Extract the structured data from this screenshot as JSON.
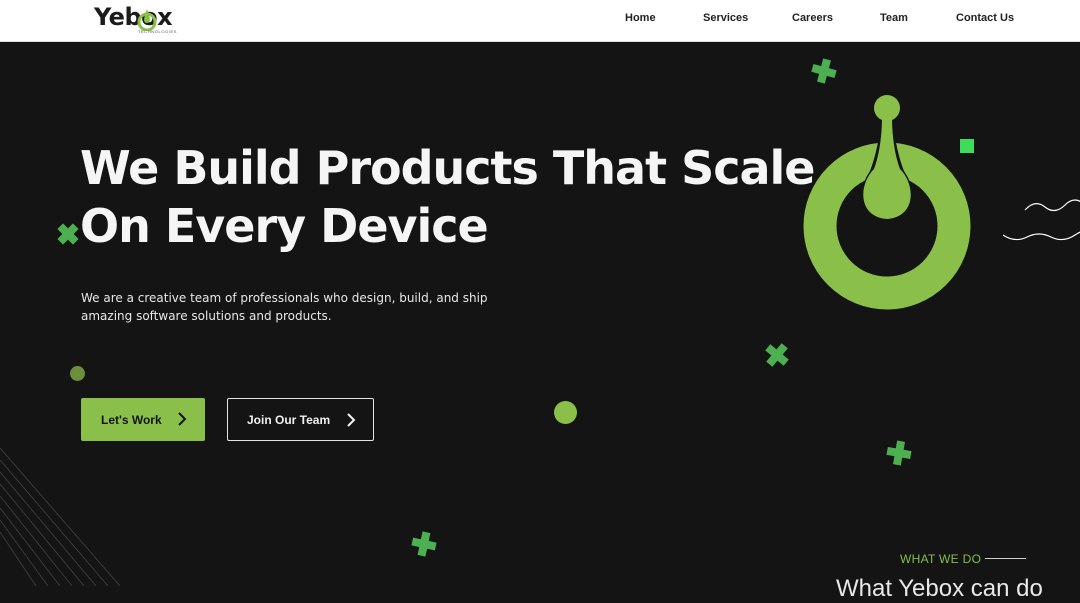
{
  "brand": {
    "name": "Yebox",
    "tagline": "TECHNOLOGIES",
    "accent_color": "#8ac04a",
    "background_color": "#141414"
  },
  "nav": {
    "links": [
      {
        "label": "Home"
      },
      {
        "label": "Services"
      },
      {
        "label": "Careers"
      },
      {
        "label": "Team"
      },
      {
        "label": "Contact Us"
      }
    ]
  },
  "hero": {
    "headline_line1": "We Build Products That Scale",
    "headline_line2": "On Every Device",
    "subtext": "We are a creative team of professionals who design, build, and ship amazing software solutions and products.",
    "primary_button": "Let's Work",
    "secondary_button": "Join Our Team"
  },
  "next_section": {
    "tag": "WHAT WE DO",
    "title_partial": "What Yebox can do"
  },
  "icons": {
    "logo": "yebox-logo",
    "hero_graphic": "yebox-drop-emblem",
    "button_arrow": "chevron-right-icon",
    "decor": [
      "plus-shape",
      "dot",
      "wave-lines",
      "diagonal-lines"
    ]
  }
}
